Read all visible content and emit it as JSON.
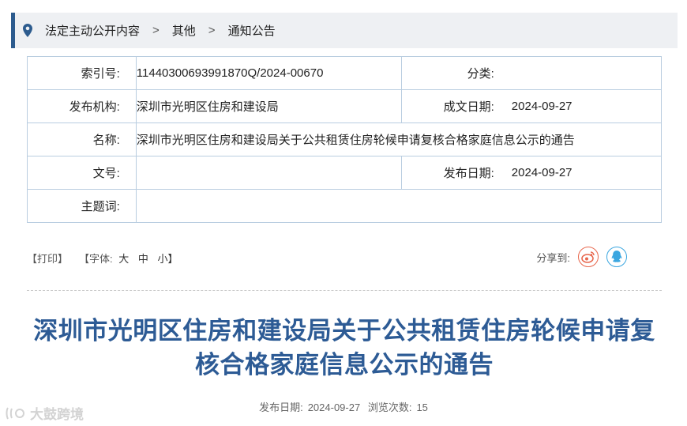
{
  "breadcrumb": {
    "items": [
      "法定主动公开内容",
      "其他",
      "通知公告"
    ],
    "separator": ">"
  },
  "meta": {
    "index_label": "索引号:",
    "index_value": "11440300693991870Q/2024-00670",
    "category_label": "分类:",
    "category_value": "",
    "publisher_label": "发布机构:",
    "publisher_value": "深圳市光明区住房和建设局",
    "created_label": "成文日期:",
    "created_value": "2024-09-27",
    "name_label": "名称:",
    "name_value": "深圳市光明区住房和建设局关于公共租赁住房轮候申请复核合格家庭信息公示的通告",
    "docno_label": "文号:",
    "docno_value": "",
    "published_label": "发布日期:",
    "published_value": "2024-09-27",
    "keywords_label": "主题词:",
    "keywords_value": ""
  },
  "toolbar": {
    "print": "【打印】",
    "font_open": "【字体:",
    "font_large": "大",
    "font_medium": "中",
    "font_small": "小】",
    "share_label": "分享到:"
  },
  "article": {
    "title_line1": "深圳市光明区住房和建设局关于公共租赁住房轮候申请复",
    "title_line2": "核合格家庭信息公示的通告",
    "pub_date_label": "发布日期:",
    "pub_date": "2024-09-27",
    "views_label": "浏览次数:",
    "views": "15"
  },
  "watermark": {
    "text": "大鼓跨境"
  },
  "colors": {
    "accent": "#2c5b8e",
    "title": "#2d5b95",
    "table_border": "#b9cde0",
    "weibo": "#e8674d",
    "qq": "#3aa6e0"
  }
}
